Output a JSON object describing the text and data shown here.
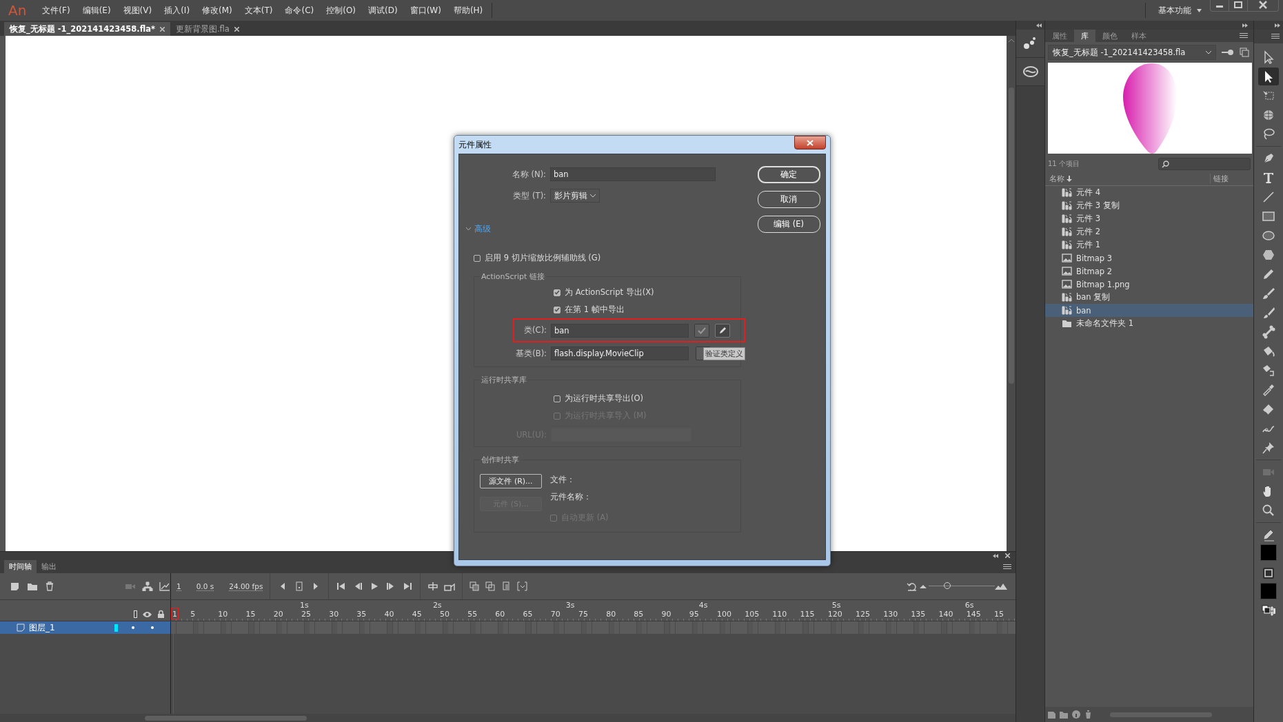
{
  "menu_bar": {
    "logo": "An",
    "items": [
      "文件(F)",
      "编辑(E)",
      "视图(V)",
      "插入(I)",
      "修改(M)",
      "文本(T)",
      "命令(C)",
      "控制(O)",
      "调试(D)",
      "窗口(W)",
      "帮助(H)"
    ],
    "workspace": "基本功能"
  },
  "document_tabs": [
    {
      "label": "恢复_无标题 -1_202141423458.fla*",
      "selected": true
    },
    {
      "label": "更新背景图.fla",
      "selected": false
    }
  ],
  "dialog": {
    "title": "元件属性",
    "name_label": "名称 (N):",
    "name_value": "ban",
    "type_label": "类型 (T):",
    "type_value": "影片剪辑",
    "buttons": [
      {
        "label": "确定",
        "default": true
      },
      {
        "label": "取消",
        "default": false
      },
      {
        "label": "编辑 (E)",
        "default": false
      }
    ],
    "advanced": {
      "label": "高级",
      "expanded": true
    },
    "nine_slice": {
      "label": "启用 9 切片缩放比例辅助线 (G)",
      "checked": false
    },
    "actionscript": {
      "title": "ActionScript 链接",
      "options": [
        {
          "label": "为 ActionScript 导出(X)",
          "checked": true,
          "disabled": false
        },
        {
          "label": "在第 1 帧中导出",
          "checked": true,
          "disabled": false
        }
      ],
      "class_label": "类(C):",
      "class_value": "ban",
      "class_highlighted": true,
      "base_label": "基类(B):",
      "base_value": "flash.display.MovieClip",
      "tooltip": "验证类定义"
    },
    "runtime": {
      "title": "运行时共享库",
      "options": [
        {
          "label": "为运行时共享导出(O)",
          "checked": false,
          "disabled": false
        },
        {
          "label": "为运行时共享导入 (M)",
          "checked": false,
          "disabled": true
        }
      ],
      "url_label": "URL(U):",
      "url_disabled": true
    },
    "authoring": {
      "title": "创作时共享",
      "source_button": "源文件 (R)...",
      "symbol_button": {
        "label": "元件 (S)...",
        "disabled": true
      },
      "file_label": "文件：",
      "symbol_name_label": "元件名称：",
      "auto_update": {
        "label": "自动更新 (A)",
        "checked": false,
        "disabled": true
      }
    }
  },
  "library": {
    "tabs": [
      {
        "label": "属性",
        "selected": false
      },
      {
        "label": "库",
        "selected": true
      },
      {
        "label": "颜色",
        "selected": false
      },
      {
        "label": "样本",
        "selected": false
      }
    ],
    "document": "恢复_无标题 -1_202141423458.fla",
    "item_count": "11 个项目",
    "columns": [
      "名称",
      "链接"
    ],
    "items": [
      {
        "name": "元件 4",
        "kind": "symbol",
        "selected": false
      },
      {
        "name": "元件 3 复制",
        "kind": "symbol",
        "selected": false
      },
      {
        "name": "元件 3",
        "kind": "symbol",
        "selected": false
      },
      {
        "name": "元件 2",
        "kind": "symbol",
        "selected": false
      },
      {
        "name": "元件 1",
        "kind": "symbol",
        "selected": false
      },
      {
        "name": "Bitmap 3",
        "kind": "bitmap",
        "selected": false
      },
      {
        "name": "Bitmap 2",
        "kind": "bitmap",
        "selected": false
      },
      {
        "name": "Bitmap 1.png",
        "kind": "bitmap",
        "selected": false
      },
      {
        "name": "ban 复制",
        "kind": "symbol",
        "selected": false
      },
      {
        "name": "ban",
        "kind": "symbol",
        "selected": true
      },
      {
        "name": "未命名文件夹 1",
        "kind": "folder",
        "selected": false
      }
    ]
  },
  "tools": [
    {
      "kind": "select",
      "selected": false
    },
    {
      "kind": "subselect",
      "selected": true
    },
    {
      "kind": "transform",
      "selected": false
    },
    {
      "kind": "rotate3d",
      "selected": false
    },
    {
      "kind": "lasso",
      "selected": false
    },
    {
      "kind": "pen",
      "selected": false
    },
    {
      "kind": "text",
      "selected": false
    },
    {
      "kind": "line",
      "selected": false
    },
    {
      "kind": "rect",
      "selected": false
    },
    {
      "kind": "oval",
      "selected": false
    },
    {
      "kind": "polystar",
      "selected": false
    },
    {
      "kind": "pencil",
      "selected": false
    },
    {
      "kind": "brush",
      "selected": false
    },
    {
      "kind": "paintbrush",
      "selected": false
    },
    {
      "kind": "bone",
      "selected": false
    },
    {
      "kind": "bucket",
      "selected": false
    },
    {
      "kind": "inkbottle",
      "selected": false
    },
    {
      "kind": "eyedropper",
      "selected": false
    },
    {
      "kind": "eraser",
      "selected": false
    },
    {
      "kind": "width",
      "selected": false
    },
    {
      "kind": "pin",
      "selected": false
    },
    {
      "kind": "camera",
      "selected": false
    },
    {
      "kind": "hand",
      "selected": false
    },
    {
      "kind": "zoom",
      "selected": false
    },
    {
      "kind": "stroke",
      "selected": false
    },
    {
      "kind": "fill",
      "selected": false
    },
    {
      "kind": "swap",
      "selected": false
    }
  ],
  "timeline": {
    "tabs": [
      {
        "label": "时间轴",
        "selected": true
      },
      {
        "label": "输出",
        "selected": false
      }
    ],
    "current_frame": "1",
    "time": "0.0 s",
    "frame_rate": "24.00 fps",
    "zoom_slider": {
      "level": 0.28
    },
    "second_labels": [
      "1s",
      "2s",
      "3s",
      "4s",
      "5s",
      "6s"
    ],
    "frame_labels": [
      "1",
      "5",
      "10",
      "15",
      "20",
      "25",
      "30",
      "35",
      "40",
      "45",
      "50",
      "55",
      "60",
      "65",
      "70",
      "75",
      "80",
      "85",
      "90",
      "95",
      "100",
      "105",
      "110",
      "115",
      "120",
      "125",
      "130",
      "135",
      "140",
      "145",
      "15"
    ],
    "layers": [
      {
        "name": "图层_1",
        "selected": true,
        "color": "#00e5ff"
      }
    ]
  }
}
